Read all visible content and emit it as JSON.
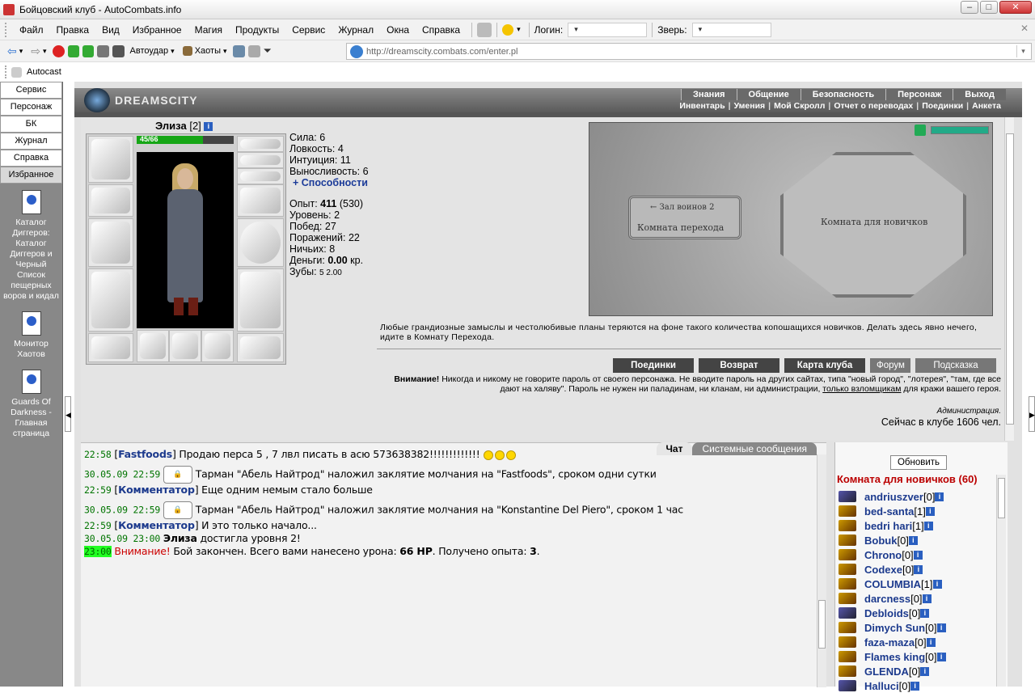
{
  "window": {
    "title": "Бойцовский клуб - AutoCombats.info"
  },
  "menu": {
    "items": [
      "Файл",
      "Правка",
      "Вид",
      "Избранное",
      "Магия",
      "Продукты",
      "Сервис",
      "Журнал",
      "Окна",
      "Справка"
    ],
    "login_label": "Логин:",
    "beast_label": "Зверь:"
  },
  "toolbar": {
    "autohit": "Автоудар",
    "chaos": "Хаоты",
    "address": "http://dreamscity.combats.com/enter.pl"
  },
  "toolbar3": {
    "autocast": "Autocast"
  },
  "sidebar": {
    "tabs": [
      "Сервис",
      "Персонаж",
      "БК",
      "Журнал",
      "Справка",
      "Избранное"
    ],
    "items": [
      "Каталог Диггеров: Каталог Диггеров и Черный Список пещерных воров и кидал",
      "Монитор Хаотов",
      "Guards Of Darkness - Главная страница"
    ]
  },
  "site": {
    "logo": "DREAMSCITY",
    "nav_top": [
      "Знания",
      "Общение",
      "Безопасность",
      "Персонаж",
      "Выход"
    ],
    "nav_sub": [
      "Инвентарь",
      "Умения",
      "Мой Скролл",
      "Отчет о переводах",
      "Поединки",
      "Анкета"
    ]
  },
  "character": {
    "name": "Элиза",
    "level": "[2]",
    "hp": "45/66",
    "hp_fraction": 0.68,
    "stats": {
      "str_label": "Сила:",
      "str": "6",
      "agi_label": "Ловкость:",
      "agi": "4",
      "int_label": "Интуиция:",
      "int": "11",
      "end_label": "Выносливость:",
      "end": "6"
    },
    "abilities_link": "+ Способности",
    "exp_label": "Опыт:",
    "exp": "411",
    "exp_next": "(530)",
    "level_label": "Уровень:",
    "level_val": "2",
    "wins_label": "Побед:",
    "wins": "27",
    "losses_label": "Поражений:",
    "losses": "22",
    "draws_label": "Ничьих:",
    "draws": "8",
    "money_label": "Деньги:",
    "money": "0.00",
    "money_unit": "кр.",
    "teeth_label": "Зубы:",
    "teeth": "5 2.00"
  },
  "map": {
    "room_left": "Комната перехода",
    "room_left_arrow": "← Зал воинов 2",
    "room_right": "Комната для новичков"
  },
  "room_text": "Любые грандиозные замыслы и честолюбивые планы теряются на фоне такого количества копошащихся новичков. Делать здесь явно нечего, идите в Комнату Перехода.",
  "buttons": [
    "Поединки",
    "Возврат",
    "Карта клуба",
    "Форум",
    "Подсказка"
  ],
  "warning": {
    "title": "Внимание!",
    "text1": " Никогда и никому не говорите пароль от своего персонажа. Не вводите пароль на других сайтах, типа \"новый город\", \"лотерея\", \"там, где все дают на халяву\". Пароль не нужен ни паладинам, ни кланам, ни администрации, ",
    "link": "только взломщикам",
    "text2": " для кражи вашего героя.",
    "admin": "Администрация.",
    "online": "Сейчас в клубе 1606 чел."
  },
  "chat": {
    "tabs": [
      "Чат",
      "Системные сообщения"
    ],
    "lines": [
      {
        "ts": "22:58",
        "name": "Fastfoods",
        "text": " Продаю перса 5 , 7 лвл писать в асю 573638382!!!!!!!!!!!!!"
      },
      {
        "ts": "30.05.09 22:59",
        "text": "Тарман \"Абель Найтрод\" наложил заклятие молчания на \"Fastfoods\", сроком одни сутки"
      },
      {
        "ts": "22:59",
        "name": "Комментатор",
        "text": " Еще одним немым стало больше"
      },
      {
        "ts": "30.05.09 22:59",
        "text": "Тарман \"Абель Найтрод\" наложил заклятие молчания на \"Konstantine Del Piero\", сроком 1 час"
      },
      {
        "ts": "22:59",
        "name": "Комментатор",
        "text": " И это только начало..."
      },
      {
        "ts": "30.05.09 23:00",
        "name": "Элиза",
        "text": " достигла уровня 2!"
      },
      {
        "ts": "23:00",
        "warn": "Внимание!",
        "text_a": " Бой закончен. Всего вами нанесено урона: ",
        "dmg": "66 HP",
        "text_b": ". Получено опыта: ",
        "xp": "3",
        "text_c": "."
      }
    ]
  },
  "users": {
    "refresh": "Обновить",
    "room_title": "Комната для новичков (60)",
    "list": [
      {
        "name": "andriuszver",
        "lvl": "[0]"
      },
      {
        "name": "bed-santa",
        "lvl": "[1]"
      },
      {
        "name": "bedri hari",
        "lvl": "[1]"
      },
      {
        "name": "Bobuk",
        "lvl": "[0]"
      },
      {
        "name": "Chrono",
        "lvl": "[0]"
      },
      {
        "name": "Codexe",
        "lvl": "[0]"
      },
      {
        "name": "COLUMBIA",
        "lvl": "[1]"
      },
      {
        "name": "darcness",
        "lvl": "[0]"
      },
      {
        "name": "Debloids",
        "lvl": "[0]"
      },
      {
        "name": "Dimych Sun",
        "lvl": "[0]"
      },
      {
        "name": "faza-maza",
        "lvl": "[0]"
      },
      {
        "name": "Flames king",
        "lvl": "[0]"
      },
      {
        "name": "GLENDA",
        "lvl": "[0]"
      },
      {
        "name": "Halluci",
        "lvl": "[0]"
      }
    ]
  }
}
